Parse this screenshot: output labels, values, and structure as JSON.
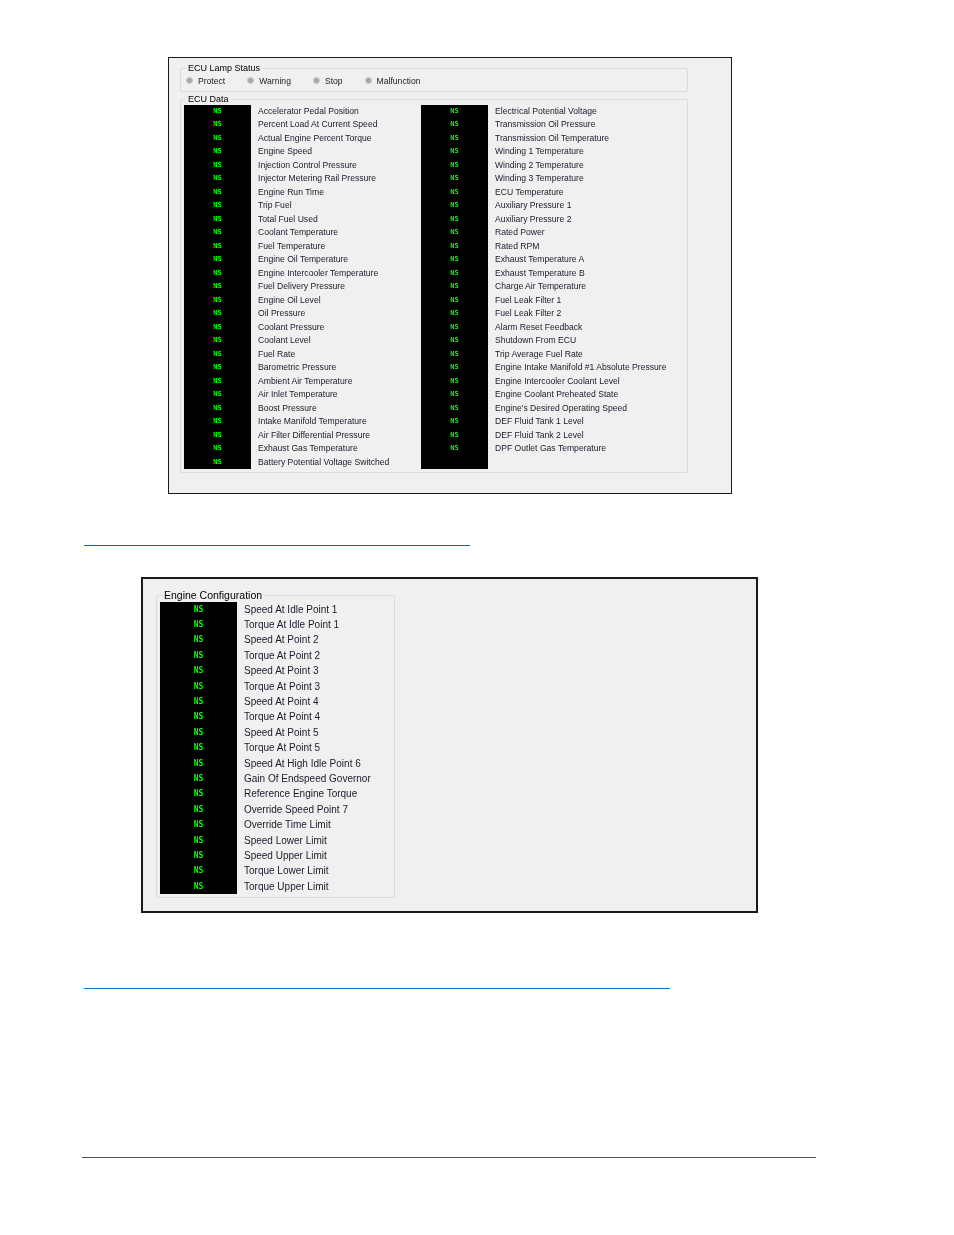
{
  "ecu_panel": {
    "lamp_status": {
      "title": "ECU Lamp Status",
      "lamps": [
        {
          "label": "Protect",
          "on": false
        },
        {
          "label": "Warning",
          "on": false
        },
        {
          "label": "Stop",
          "on": false
        },
        {
          "label": "Malfunction",
          "on": false
        }
      ]
    },
    "ecu_data": {
      "title": "ECU Data",
      "columns": [
        {
          "rows": [
            {
              "value": "NS",
              "label": "Accelerator Pedal Position"
            },
            {
              "value": "NS",
              "label": "Percent Load At Current Speed"
            },
            {
              "value": "NS",
              "label": "Actual Engine Percent Torque"
            },
            {
              "value": "NS",
              "label": "Engine Speed"
            },
            {
              "value": "NS",
              "label": "Injection Control Pressure"
            },
            {
              "value": "NS",
              "label": "Injector Metering Rail Pressure"
            },
            {
              "value": "NS",
              "label": "Engine Run Time"
            },
            {
              "value": "NS",
              "label": "Trip Fuel"
            },
            {
              "value": "NS",
              "label": "Total Fuel Used"
            },
            {
              "value": "NS",
              "label": "Coolant Temperature"
            },
            {
              "value": "NS",
              "label": "Fuel Temperature"
            },
            {
              "value": "NS",
              "label": "Engine Oil Temperature"
            },
            {
              "value": "NS",
              "label": "Engine Intercooler Temperature"
            },
            {
              "value": "NS",
              "label": "Fuel Delivery Pressure"
            },
            {
              "value": "NS",
              "label": "Engine Oil Level"
            },
            {
              "value": "NS",
              "label": "Oil Pressure"
            },
            {
              "value": "NS",
              "label": "Coolant Pressure"
            },
            {
              "value": "NS",
              "label": "Coolant Level"
            },
            {
              "value": "NS",
              "label": "Fuel Rate"
            },
            {
              "value": "NS",
              "label": "Barometric Pressure"
            },
            {
              "value": "NS",
              "label": "Ambient Air Temperature"
            },
            {
              "value": "NS",
              "label": "Air Inlet Temperature"
            },
            {
              "value": "NS",
              "label": "Boost Pressure"
            },
            {
              "value": "NS",
              "label": "Intake Manifold Temperature"
            },
            {
              "value": "NS",
              "label": "Air Filter Differential Pressure"
            },
            {
              "value": "NS",
              "label": "Exhaust Gas Temperature"
            },
            {
              "value": "NS",
              "label": "Battery Potential Voltage Switched"
            }
          ]
        },
        {
          "rows": [
            {
              "value": "NS",
              "label": "Electrical Potential Voltage"
            },
            {
              "value": "NS",
              "label": "Transmission Oil Pressure"
            },
            {
              "value": "NS",
              "label": "Transmission Oil Temperature"
            },
            {
              "value": "NS",
              "label": "Winding 1 Temperature"
            },
            {
              "value": "NS",
              "label": "Winding 2 Temperature"
            },
            {
              "value": "NS",
              "label": "Winding 3 Temperature"
            },
            {
              "value": "NS",
              "label": "ECU Temperature"
            },
            {
              "value": "NS",
              "label": "Auxiliary Pressure 1"
            },
            {
              "value": "NS",
              "label": "Auxiliary Pressure 2"
            },
            {
              "value": "NS",
              "label": "Rated Power"
            },
            {
              "value": "NS",
              "label": "Rated RPM"
            },
            {
              "value": "NS",
              "label": "Exhaust Temperature A"
            },
            {
              "value": "NS",
              "label": "Exhaust Temperature B"
            },
            {
              "value": "NS",
              "label": "Charge Air Temperature"
            },
            {
              "value": "NS",
              "label": "Fuel Leak Filter 1"
            },
            {
              "value": "NS",
              "label": "Fuel Leak Filter 2"
            },
            {
              "value": "NS",
              "label": "Alarm Reset Feedback"
            },
            {
              "value": "NS",
              "label": "Shutdown From ECU"
            },
            {
              "value": "NS",
              "label": "Trip Average Fuel Rate"
            },
            {
              "value": "NS",
              "label": "Engine Intake Manifold #1 Absolute Pressure"
            },
            {
              "value": "NS",
              "label": "Engine Intercooler Coolant Level"
            },
            {
              "value": "NS",
              "label": "Engine Coolant Preheated State"
            },
            {
              "value": "NS",
              "label": "Engine's Desired Operating Speed"
            },
            {
              "value": "NS",
              "label": "DEF Fluid Tank 1 Level"
            },
            {
              "value": "NS",
              "label": "DEF Fluid Tank 2 Level"
            },
            {
              "value": "NS",
              "label": "DPF Outlet Gas Temperature"
            }
          ]
        }
      ]
    }
  },
  "engine_configuration": {
    "title": "Engine Configuration",
    "rows": [
      {
        "value": "NS",
        "label": "Speed At Idle Point 1"
      },
      {
        "value": "NS",
        "label": "Torque At Idle Point 1"
      },
      {
        "value": "NS",
        "label": "Speed At Point 2"
      },
      {
        "value": "NS",
        "label": "Torque At Point 2"
      },
      {
        "value": "NS",
        "label": "Speed At Point 3"
      },
      {
        "value": "NS",
        "label": "Torque At Point 3"
      },
      {
        "value": "NS",
        "label": "Speed At Point 4"
      },
      {
        "value": "NS",
        "label": "Torque At Point 4"
      },
      {
        "value": "NS",
        "label": "Speed At Point 5"
      },
      {
        "value": "NS",
        "label": "Torque At Point 5"
      },
      {
        "value": "NS",
        "label": "Speed At High Idle Point 6"
      },
      {
        "value": "NS",
        "label": "Gain Of Endspeed Governor"
      },
      {
        "value": "NS",
        "label": "Reference Engine Torque"
      },
      {
        "value": "NS",
        "label": "Override Speed Point 7"
      },
      {
        "value": "NS",
        "label": "Override Time Limit"
      },
      {
        "value": "NS",
        "label": "Speed Lower Limit"
      },
      {
        "value": "NS",
        "label": "Speed Upper Limit"
      },
      {
        "value": "NS",
        "label": "Torque Lower Limit"
      },
      {
        "value": "NS",
        "label": "Torque Upper Limit"
      }
    ]
  }
}
